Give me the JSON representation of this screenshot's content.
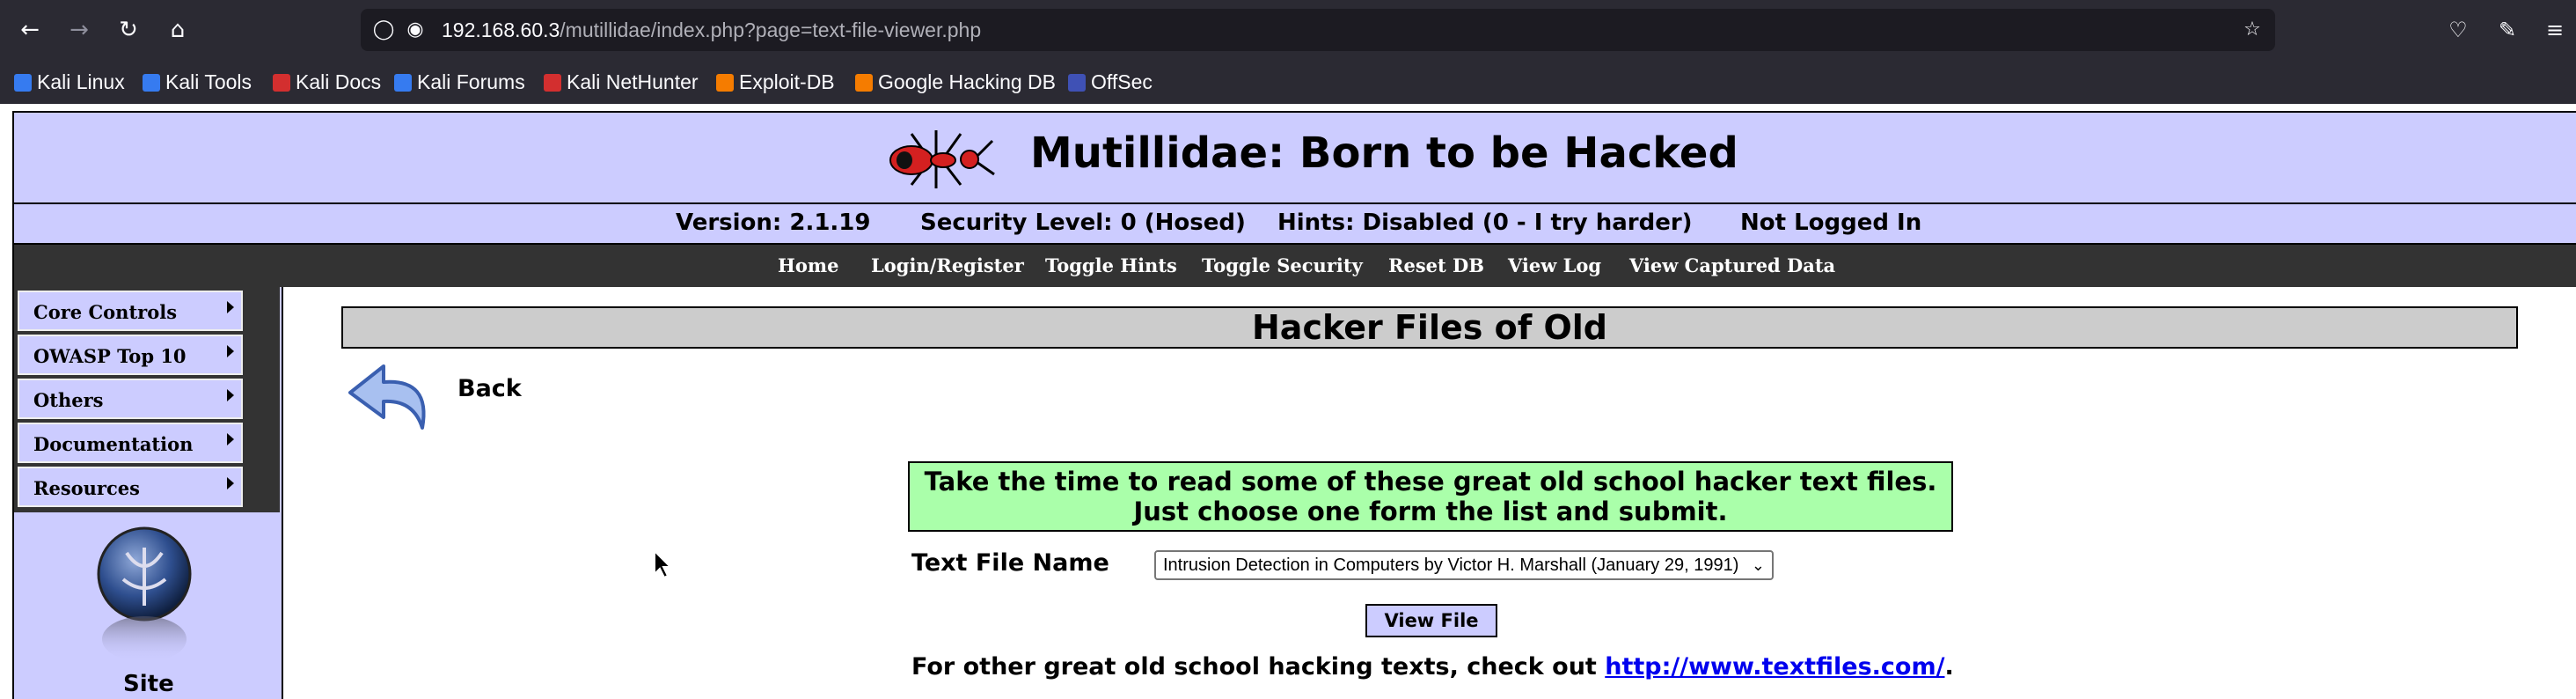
{
  "browser": {
    "url_host": "192.168.60.3",
    "url_path": "/mutillidae/index.php?page=text-file-viewer.php",
    "bookmarks": [
      {
        "label": "Kali Linux",
        "color": "#367bf0"
      },
      {
        "label": "Kali Tools",
        "color": "#367bf0"
      },
      {
        "label": "Kali Docs",
        "color": "#d32f2f"
      },
      {
        "label": "Kali Forums",
        "color": "#367bf0"
      },
      {
        "label": "Kali NetHunter",
        "color": "#d32f2f"
      },
      {
        "label": "Exploit-DB",
        "color": "#f57c00"
      },
      {
        "label": "Google Hacking DB",
        "color": "#f57c00"
      },
      {
        "label": "OffSec",
        "color": "#3f51b5"
      }
    ]
  },
  "header": {
    "title": "Mutillidae: Born to be Hacked"
  },
  "status": {
    "version": "Version: 2.1.19",
    "security": "Security Level: 0 (Hosed)",
    "hints": "Hints: Disabled (0 - I try harder)",
    "login": "Not Logged In"
  },
  "menu": {
    "items": [
      "Home",
      "Login/Register",
      "Toggle Hints",
      "Toggle Security",
      "Reset DB",
      "View Log",
      "View Captured Data"
    ]
  },
  "sidebar": {
    "items": [
      "Core Controls",
      "OWASP Top 10",
      "Others",
      "Documentation",
      "Resources"
    ],
    "site_label": "Site"
  },
  "main": {
    "title": "Hacker Files of Old",
    "back_label": "Back",
    "info_line1": "Take the time to read some of these great old school hacker text files.",
    "info_line2": "Just choose one form the list and submit.",
    "file_label": "Text File Name",
    "file_selected": "Intrusion Detection in Computers by Victor H. Marshall (January 29, 1991)",
    "view_button": "View File",
    "other_prefix": "For other great old school hacking texts, check out ",
    "other_link": "http://www.textfiles.com/",
    "other_suffix": "."
  },
  "colors": {
    "header_bg": "#ccccff",
    "menu_bg": "#333333",
    "info_bg": "#aaffaa",
    "title_bg": "#cccccc"
  }
}
